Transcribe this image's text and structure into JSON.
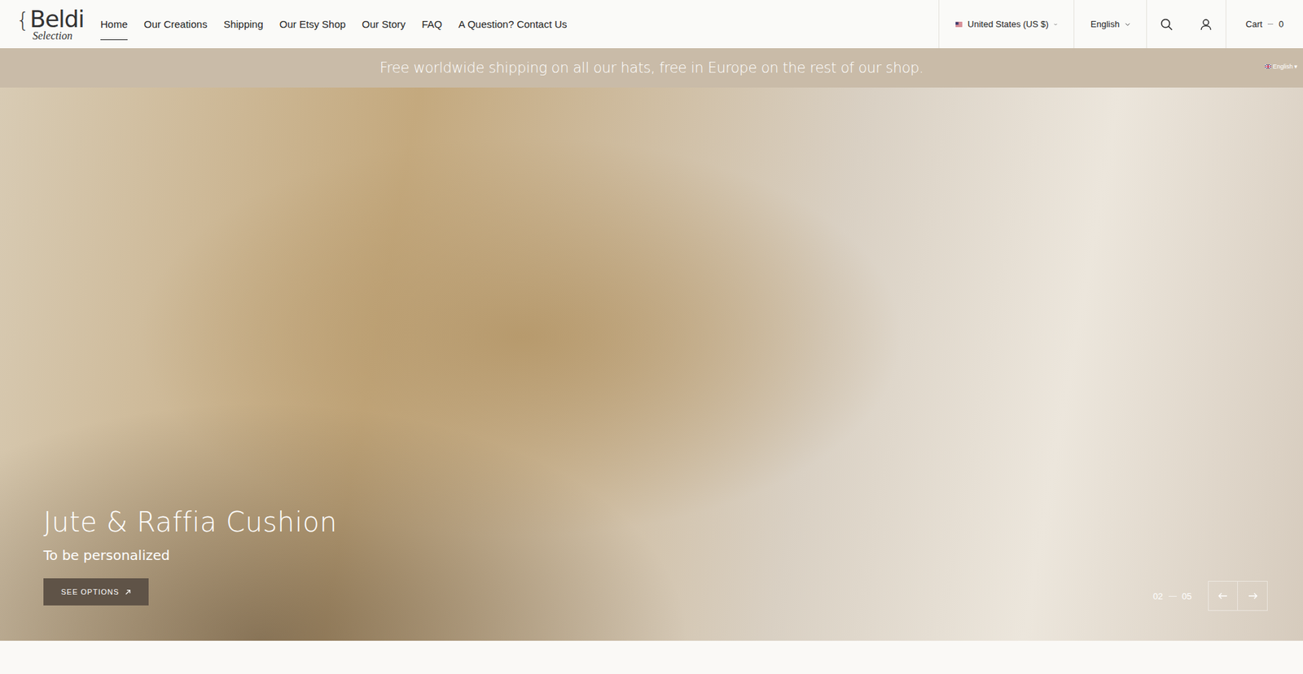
{
  "logo": {
    "mark": "{",
    "name": "Beldi",
    "tagline": "Selection"
  },
  "nav": [
    {
      "label": "Home",
      "selected": true
    },
    {
      "label": "Our Creations",
      "selected": false
    },
    {
      "label": "Shipping",
      "selected": false
    },
    {
      "label": "Our Etsy Shop",
      "selected": false
    },
    {
      "label": "Our Story",
      "selected": false
    },
    {
      "label": "FAQ",
      "selected": false
    },
    {
      "label": "A Question? Contact Us",
      "selected": false
    }
  ],
  "region": {
    "label": "United States (US $)"
  },
  "language": {
    "label": "English"
  },
  "cart": {
    "label": "Cart",
    "count": "0"
  },
  "announcement": {
    "text": "Free worldwide shipping on all our hats, free in Europe on the rest of our shop.",
    "language": "English",
    "caret": "▾"
  },
  "hero": {
    "title": "Jute & Raffia Cushion",
    "subtitle": "To be personalized",
    "button": "SEE OPTIONS",
    "current": "02",
    "total": "05"
  }
}
